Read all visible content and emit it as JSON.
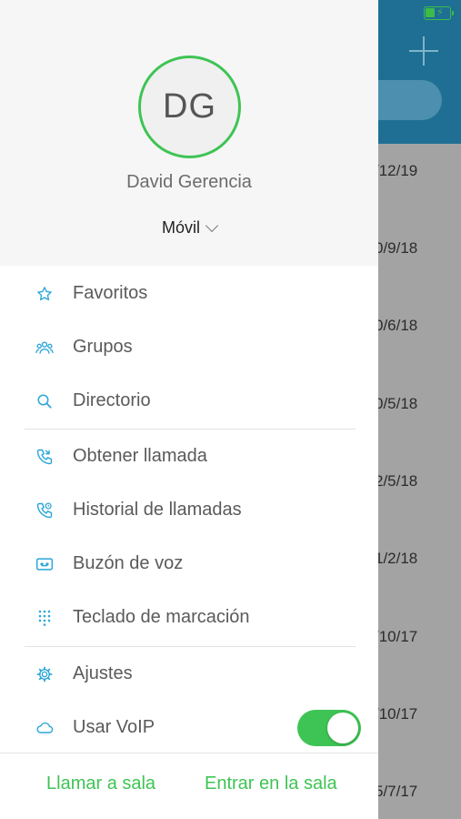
{
  "background": {
    "dates": [
      "/12/19",
      "0/9/18",
      "0/6/18",
      "0/5/18",
      "2/5/18",
      "1/2/18",
      "/10/17",
      "/10/17",
      "5/7/17"
    ],
    "header_color": "#1f6f94"
  },
  "colors": {
    "accent": "#3ec454",
    "icon": "#2aa6d8"
  },
  "profile": {
    "initials": "DG",
    "name": "David Gerencia",
    "device": "Móvil"
  },
  "menu": {
    "favorites": "Favoritos",
    "groups": "Grupos",
    "directory": "Directorio",
    "pickup": "Obtener llamada",
    "history": "Historial de llamadas",
    "voicemail": "Buzón de voz",
    "dialpad": "Teclado de marcación",
    "settings": "Ajustes",
    "voip": "Usar VoIP",
    "voip_enabled": true
  },
  "footer": {
    "call_room": "Llamar a sala",
    "join_room": "Entrar en la sala"
  }
}
